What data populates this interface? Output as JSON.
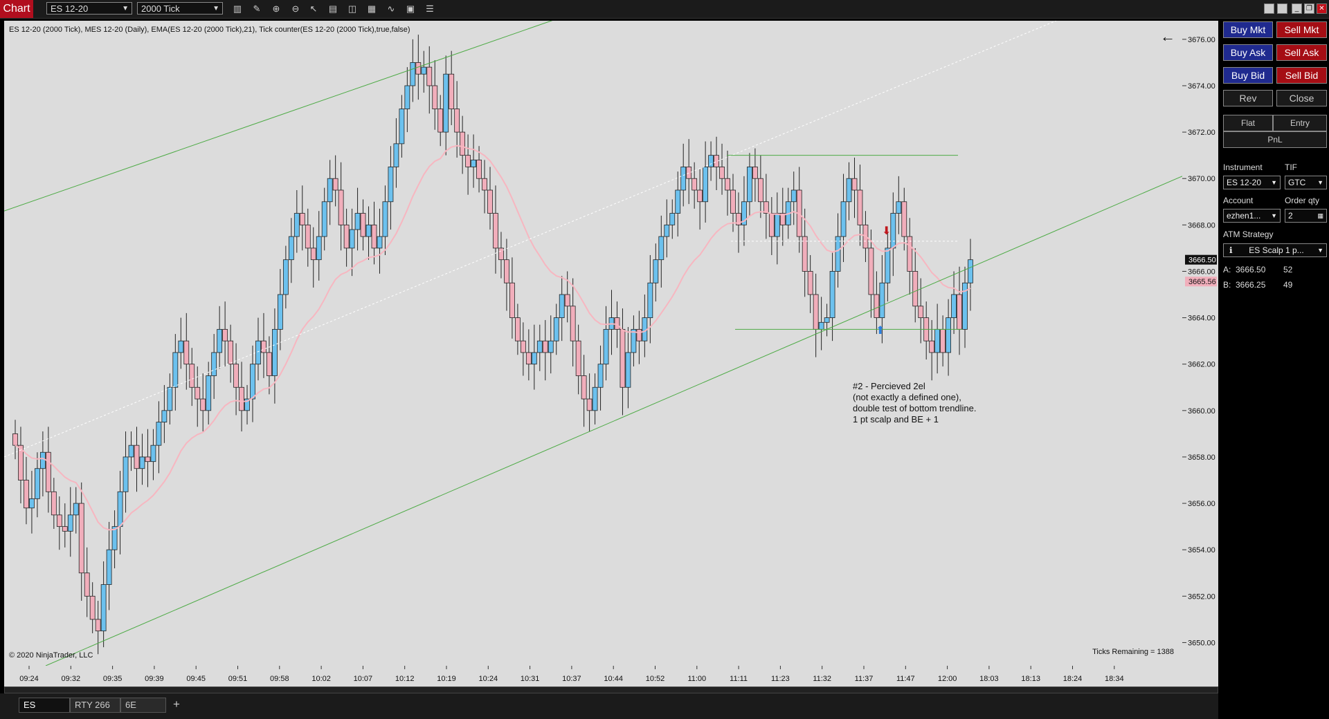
{
  "app": {
    "title": "Chart"
  },
  "toolbar": {
    "instrument": "ES 12-20",
    "interval": "2000 Tick"
  },
  "chart_header": "ES 12-20 (2000 Tick), MES 12-20 (Daily), EMA(ES 12-20 (2000 Tick),21), Tick counter(ES 12-20 (2000 Tick),true,false)",
  "copyright": "© 2020 NinjaTrader, LLC",
  "ticks_remaining": "Ticks Remaining = 1388",
  "annotation": "#2 - Percieved 2el\n(not exactly a defined one),\ndouble test of bottom trendline.\n1 pt scalp and BE + 1",
  "colors": {
    "up": "#6cc1ee",
    "down": "#f1aebb",
    "ema": "#f7b6c0",
    "trend": "#4caa44",
    "bg": "#dcdcdc"
  },
  "tabs": [
    {
      "label": "ES"
    },
    {
      "label": "RTY 266"
    },
    {
      "label": "6E"
    }
  ],
  "side": {
    "buy_mkt": "Buy Mkt",
    "sell_mkt": "Sell Mkt",
    "buy_ask": "Buy Ask",
    "sell_ask": "Sell Ask",
    "buy_bid": "Buy Bid",
    "sell_bid": "Sell Bid",
    "rev": "Rev",
    "close": "Close",
    "flat": "Flat",
    "entry": "Entry",
    "pnl": "PnL",
    "instrument_label": "Instrument",
    "instrument": "ES 12-20",
    "tif_label": "TIF",
    "tif": "GTC",
    "account_label": "Account",
    "account": "ezhen1...",
    "qty_label": "Order qty",
    "qty": "2",
    "atm_label": "ATM Strategy",
    "atm": "ES Scalp 1 p...",
    "ask_label": "A:",
    "ask_price": "3666.50",
    "ask_size": "52",
    "bid_label": "B:",
    "bid_price": "3666.25",
    "bid_size": "49"
  },
  "chart_data": {
    "type": "candlestick",
    "ylim": [
      3649,
      3676.8
    ],
    "y_ticks": [
      3650,
      3652,
      3654,
      3656,
      3658,
      3660,
      3662,
      3664,
      3666,
      3668,
      3670,
      3672,
      3674,
      3676
    ],
    "x_ticks": [
      "09:24",
      "09:32",
      "09:35",
      "09:39",
      "09:45",
      "09:51",
      "09:58",
      "10:02",
      "10:07",
      "10:12",
      "10:19",
      "10:24",
      "10:31",
      "10:37",
      "10:44",
      "10:52",
      "11:00",
      "11:11",
      "11:23",
      "11:32",
      "11:37",
      "11:47",
      "12:00",
      "18:03",
      "18:13",
      "18:24",
      "18:34"
    ],
    "last_price": "3666.50",
    "ema_price": "3665.56",
    "close": [
      3658.5,
      3657.0,
      3655.8,
      3656.2,
      3657.5,
      3658.2,
      3656.5,
      3655.5,
      3655.0,
      3654.8,
      3655.5,
      3656.0,
      3653.0,
      3652.0,
      3651.0,
      3650.5,
      3652.5,
      3654.0,
      3655.0,
      3656.5,
      3658.0,
      3658.5,
      3657.5,
      3658.0,
      3657.8,
      3658.5,
      3659.5,
      3660.0,
      3661.0,
      3662.5,
      3663.0,
      3662.0,
      3661.0,
      3660.5,
      3660.0,
      3661.5,
      3662.5,
      3663.5,
      3663.0,
      3662.0,
      3661.0,
      3660.0,
      3660.5,
      3662.0,
      3663.0,
      3662.5,
      3661.5,
      3663.5,
      3665.0,
      3666.5,
      3667.5,
      3668.5,
      3668.0,
      3667.0,
      3666.5,
      3667.5,
      3669.0,
      3670.0,
      3669.5,
      3668.0,
      3667.0,
      3667.8,
      3668.5,
      3667.5,
      3668.0,
      3667.0,
      3667.5,
      3669.0,
      3670.5,
      3671.5,
      3673.0,
      3674.0,
      3675.0,
      3674.5,
      3674.8,
      3674.0,
      3673.0,
      3672.0,
      3674.5,
      3673.0,
      3672.0,
      3671.0,
      3670.5,
      3670.8,
      3670.0,
      3669.5,
      3668.5,
      3667.0,
      3666.5,
      3665.5,
      3664.0,
      3663.0,
      3662.5,
      3662.0,
      3662.5,
      3663.0,
      3662.5,
      3663.0,
      3664.0,
      3665.0,
      3664.5,
      3663.0,
      3661.5,
      3660.5,
      3660.0,
      3661.0,
      3662.0,
      3663.5,
      3664.0,
      3663.5,
      3661.0,
      3662.5,
      3663.5,
      3663.0,
      3664.0,
      3665.5,
      3666.5,
      3667.5,
      3668.0,
      3668.5,
      3669.5,
      3670.5,
      3670.0,
      3669.5,
      3669.0,
      3670.5,
      3671.0,
      3670.5,
      3670.0,
      3669.5,
      3668.5,
      3668.0,
      3669.0,
      3670.5,
      3670.0,
      3669.0,
      3668.5,
      3667.5,
      3668.5,
      3668.0,
      3669.0,
      3669.5,
      3667.5,
      3666.0,
      3665.0,
      3663.5,
      3663.8,
      3664.0,
      3666.0,
      3667.5,
      3669.0,
      3670.0,
      3669.5,
      3668.0,
      3667.0,
      3665.0,
      3664.0,
      3665.5,
      3667.0,
      3668.5,
      3669.0,
      3667.5,
      3666.0,
      3664.5,
      3664.0,
      3663.0,
      3662.5,
      3663.5,
      3662.5,
      3664.0,
      3665.0,
      3663.5,
      3665.5,
      3666.5
    ]
  }
}
